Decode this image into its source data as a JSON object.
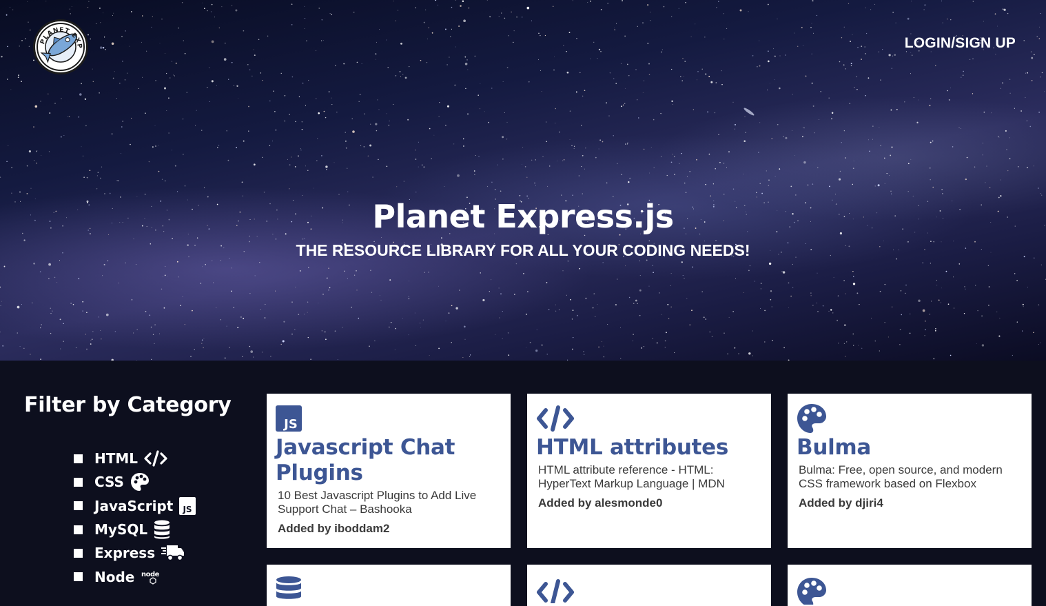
{
  "header": {
    "logo_text": "PLANET EXPRESS.js",
    "login_label": "LOGIN/SIGN UP"
  },
  "hero": {
    "title": "Planet Express.js",
    "subtitle": "THE RESOURCE LIBRARY FOR ALL YOUR CODING NEEDS!"
  },
  "sidebar": {
    "title": "Filter by Category",
    "categories": [
      {
        "label": "HTML",
        "icon": "code-icon"
      },
      {
        "label": "CSS",
        "icon": "palette-icon"
      },
      {
        "label": "JavaScript",
        "icon": "js-icon"
      },
      {
        "label": "MySQL",
        "icon": "database-icon"
      },
      {
        "label": "Express",
        "icon": "truck-icon"
      },
      {
        "label": "Node",
        "icon": "node-icon"
      }
    ]
  },
  "cards": [
    {
      "icon": "js-icon",
      "title": "Javascript Chat Plugins",
      "description": "10 Best Javascript Plugins to Add Live Support Chat – Bashooka",
      "author": "Added by iboddam2"
    },
    {
      "icon": "code-icon",
      "title": "HTML attributes",
      "description": "HTML attribute reference - HTML: HyperText Markup Language | MDN",
      "author": "Added by alesmonde0"
    },
    {
      "icon": "palette-icon",
      "title": "Bulma",
      "description": "Bulma: Free, open source, and modern CSS framework based on Flexbox",
      "author": "Added by djiri4"
    }
  ],
  "cards_row2_icons": [
    "database-icon",
    "code-icon",
    "palette-icon"
  ],
  "colors": {
    "card_title": "#3d5694",
    "page_background": "#0d0f1e",
    "text_white": "#ffffff"
  }
}
